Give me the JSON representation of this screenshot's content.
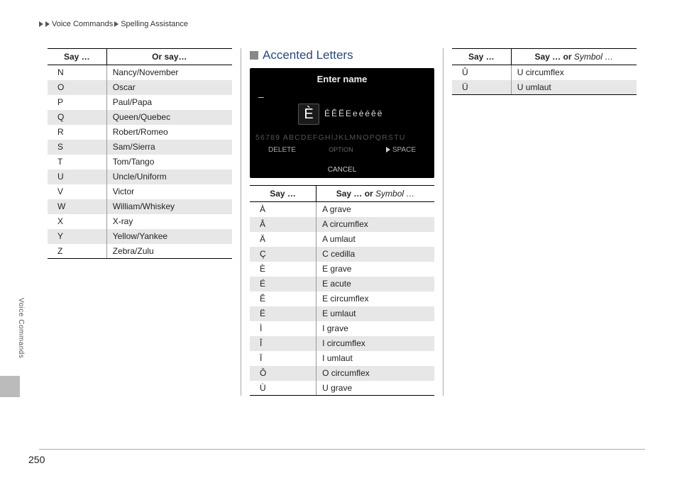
{
  "breadcrumb": {
    "a": "Voice Commands",
    "b": "Spelling Assistance"
  },
  "sideTab": "Voice Commands",
  "pageNumber": "250",
  "leftTable": {
    "h1": "Say …",
    "h2": "Or say…",
    "rows": [
      {
        "c1": "N",
        "c2": "Nancy/November"
      },
      {
        "c1": "O",
        "c2": "Oscar"
      },
      {
        "c1": "P",
        "c2": "Paul/Papa"
      },
      {
        "c1": "Q",
        "c2": "Queen/Quebec"
      },
      {
        "c1": "R",
        "c2": "Robert/Romeo"
      },
      {
        "c1": "S",
        "c2": "Sam/Sierra"
      },
      {
        "c1": "T",
        "c2": "Tom/Tango"
      },
      {
        "c1": "U",
        "c2": "Uncle/Uniform"
      },
      {
        "c1": "V",
        "c2": "Victor"
      },
      {
        "c1": "W",
        "c2": "William/Whiskey"
      },
      {
        "c1": "X",
        "c2": "X-ray"
      },
      {
        "c1": "Y",
        "c2": "Yellow/Yankee"
      },
      {
        "c1": "Z",
        "c2": "Zebra/Zulu"
      }
    ]
  },
  "sectionTitle": "Accented Letters",
  "screen": {
    "title": "Enter name",
    "big": "È",
    "row": "ÉÊËEeèéêë",
    "alpha": "56789  ABCDEFGHIJKLMNOPQRSTU",
    "delete": "DELETE",
    "option": "OPTION",
    "space": "SPACE",
    "cancel": "CANCEL"
  },
  "midTable": {
    "h1": "Say …",
    "h2a": "Say … or",
    "h2b": " Symbol …",
    "rows": [
      {
        "c1": "À",
        "c2": "A grave"
      },
      {
        "c1": "Â",
        "c2": "A circumflex"
      },
      {
        "c1": "Ä",
        "c2": "A umlaut"
      },
      {
        "c1": "Ç",
        "c2": "C cedilla"
      },
      {
        "c1": "È",
        "c2": "E grave"
      },
      {
        "c1": "É",
        "c2": "E acute"
      },
      {
        "c1": "Ê",
        "c2": "E circumflex"
      },
      {
        "c1": "Ë",
        "c2": "E umlaut"
      },
      {
        "c1": "Ì",
        "c2": "I grave"
      },
      {
        "c1": "Î",
        "c2": "I circumflex"
      },
      {
        "c1": "Ï",
        "c2": "I umlaut"
      },
      {
        "c1": "Ô",
        "c2": "O circumflex"
      },
      {
        "c1": "Ù",
        "c2": "U grave"
      }
    ]
  },
  "rightTable": {
    "h1": "Say …",
    "h2a": "Say … or",
    "h2b": " Symbol …",
    "rows": [
      {
        "c1": "Û",
        "c2": "U circumflex"
      },
      {
        "c1": "Ü",
        "c2": "U umlaut"
      }
    ]
  }
}
